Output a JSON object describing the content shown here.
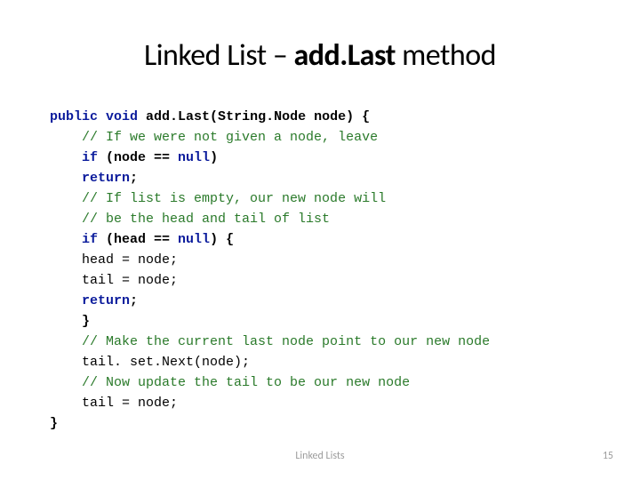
{
  "title": {
    "part1": "Linked List – ",
    "part2_bold": "add.Last ",
    "part3": "method"
  },
  "code": {
    "l1_kw1": "public",
    "l1_kw2": "void",
    "l1_rest": " add.Last(String.Node node) {",
    "l2": "// If we were not given a node, leave",
    "l3_kw": "if",
    "l3_rest": " (node == ",
    "l3_null": "null",
    "l3_end": ")",
    "l4_kw": "return",
    "l4_end": ";",
    "l5": "// If list is empty, our new node will",
    "l6": "// be the head and tail of list",
    "l7_kw": "if",
    "l7_rest": " (head == ",
    "l7_null": "null",
    "l7_end": ") {",
    "l8": "head = node;",
    "l9": "tail = node;",
    "l10_kw": "return",
    "l10_end": ";",
    "l11": "}",
    "l12": "// Make the current last node point to our new node",
    "l13": "tail. set.Next(node);",
    "l14": "// Now update the tail to be our new node",
    "l15": "tail = node;",
    "l16": "}"
  },
  "footer": {
    "center": "Linked Lists",
    "page": "15"
  }
}
